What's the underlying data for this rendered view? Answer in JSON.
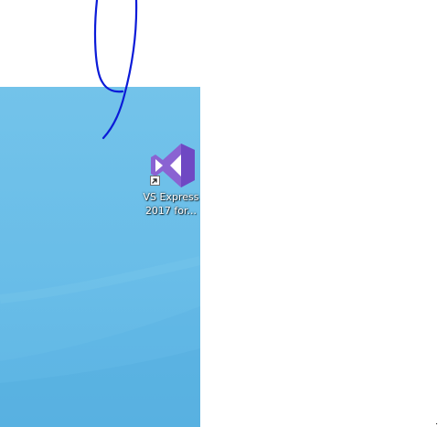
{
  "desktop": {
    "background_color": "#6ebfe9",
    "shortcut": {
      "label_line1": "VS Express",
      "label_line2": "2017 for...",
      "icon": "visual-studio-icon",
      "overlay_icon": "shortcut-arrow-icon",
      "icon_color": "#8a63d2"
    }
  },
  "annotation": {
    "stroke_color": "#0b1bd8",
    "type": "hand-drawn-curve"
  }
}
